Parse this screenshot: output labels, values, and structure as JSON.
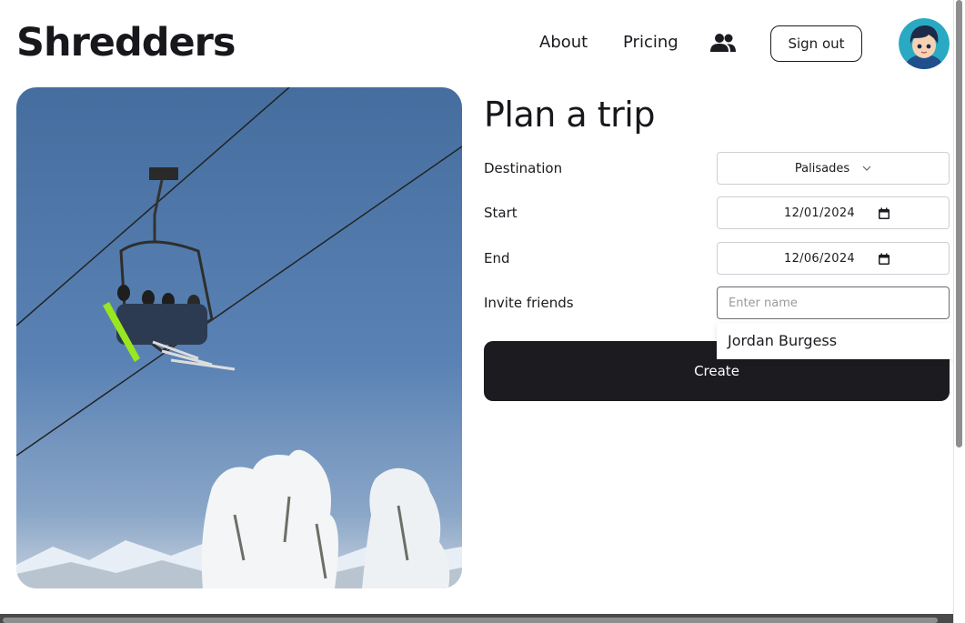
{
  "header": {
    "brand": "Shredders",
    "nav": {
      "about": "About",
      "pricing": "Pricing"
    },
    "signout_label": "Sign out",
    "icons": {
      "friends": "users-icon",
      "avatar": "user-avatar"
    }
  },
  "form": {
    "title": "Plan a trip",
    "destination": {
      "label": "Destination",
      "value": "Palisades"
    },
    "start": {
      "label": "Start",
      "value": "12/01/2024"
    },
    "end": {
      "label": "End",
      "value": "12/06/2024"
    },
    "invite": {
      "label": "Invite friends",
      "placeholder": "Enter name",
      "value": ""
    },
    "create_label": "Create"
  },
  "suggestions": [
    "Jordan Burgess"
  ],
  "colors": {
    "primary": "#1b1b20",
    "sky": "#3e6aa6",
    "avatar_bg": "#2aa9c2"
  }
}
